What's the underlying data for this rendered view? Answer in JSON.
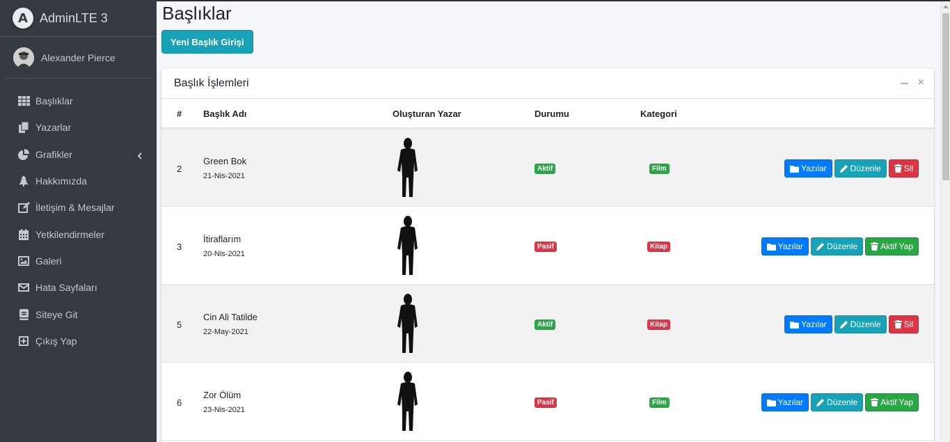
{
  "brand": {
    "name": "AdminLTE 3",
    "logo_letter": "A"
  },
  "user": {
    "name": "Alexander Pierce"
  },
  "sidebar": {
    "items": [
      {
        "label": "Başlıklar",
        "icon": "grid-icon"
      },
      {
        "label": "Yazarlar",
        "icon": "copy-icon"
      },
      {
        "label": "Grafikler",
        "icon": "pie-chart-icon"
      },
      {
        "label": "Hakkımızda",
        "icon": "tree-icon"
      },
      {
        "label": "İletişim & Mesajlar",
        "icon": "edit-icon"
      },
      {
        "label": "Yetkilendirmeler",
        "icon": "calendar-icon"
      },
      {
        "label": "Galeri",
        "icon": "image-icon"
      },
      {
        "label": "Hata Sayfaları",
        "icon": "envelope-icon"
      },
      {
        "label": "Siteye Git",
        "icon": "book-icon"
      },
      {
        "label": "Çıkış Yap",
        "icon": "plus-square-icon"
      }
    ]
  },
  "page": {
    "title": "Başlıklar",
    "new_button": "Yeni Başlık Girişi"
  },
  "card": {
    "title": "Başlık İşlemleri"
  },
  "table": {
    "headers": {
      "index": "#",
      "title": "Başlık Adı",
      "author": "Oluşturan Yazar",
      "status": "Durumu",
      "category": "Kategori"
    },
    "rows": [
      {
        "id": "2",
        "title": "Green Bok",
        "date": "21-Nis-2021",
        "status": "Aktif",
        "category": "Film",
        "third_action": "Sil"
      },
      {
        "id": "3",
        "title": "İtiraflarım",
        "date": "20-Nis-2021",
        "status": "Pasif",
        "category": "Kitap",
        "third_action": "Aktif Yap"
      },
      {
        "id": "5",
        "title": "Cin Ali Tatilde",
        "date": "22-May-2021",
        "status": "Aktif",
        "category": "Kitap",
        "third_action": "Sil"
      },
      {
        "id": "6",
        "title": "Zor Ölüm",
        "date": "23-Nis-2021",
        "status": "Pasif",
        "category": "Film",
        "third_action": "Aktif Yap"
      }
    ],
    "actions": {
      "posts": "Yazılar",
      "edit": "Düzenle"
    }
  },
  "colors": {
    "sidebar_bg": "#343a40",
    "primary": "#007bff",
    "info": "#17a2b8",
    "success": "#28a745",
    "danger": "#dc3545"
  }
}
